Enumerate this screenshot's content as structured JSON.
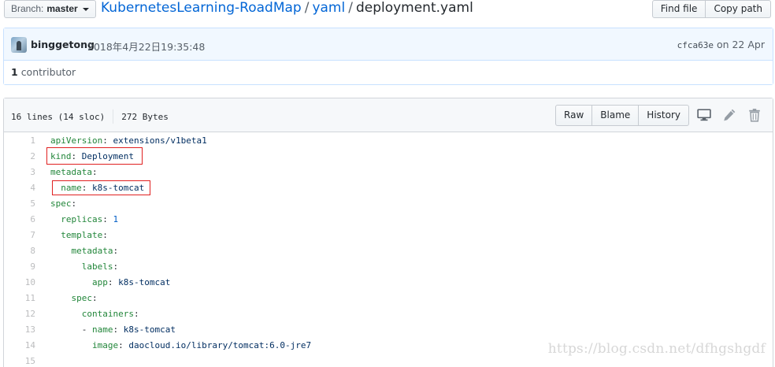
{
  "topbar": {
    "branch_label": "Branch:",
    "branch_value": "master",
    "repo": "KubernetesLearning-RoadMap",
    "separator": "/",
    "folder": "yaml",
    "file": "deployment.yaml",
    "find_file": "Find file",
    "copy_path": "Copy path"
  },
  "commit": {
    "author": "binggetong",
    "message": "2018年4月22日19:35:48",
    "sha": "cfca63e",
    "date_text": "on 22 Apr",
    "contributors_count": "1",
    "contributors_label": "contributor"
  },
  "file": {
    "lines_info": "16 lines (14 sloc)",
    "size": "272 Bytes",
    "raw": "Raw",
    "blame": "Blame",
    "history": "History",
    "icons": [
      "desktop-icon",
      "pencil-icon",
      "trash-icon"
    ],
    "lines": [
      {
        "n": "1",
        "indent": "",
        "key": "apiVersion",
        "val": "extensions/v1beta1",
        "num": false
      },
      {
        "n": "2",
        "indent": "",
        "key": "kind",
        "val": "Deployment",
        "num": false
      },
      {
        "n": "3",
        "indent": "",
        "key": "metadata",
        "val": "",
        "num": false
      },
      {
        "n": "4",
        "indent": "  ",
        "key": "name",
        "val": "k8s-tomcat",
        "num": false
      },
      {
        "n": "5",
        "indent": "",
        "key": "spec",
        "val": "",
        "num": false
      },
      {
        "n": "6",
        "indent": "  ",
        "key": "replicas",
        "val": "1",
        "num": true
      },
      {
        "n": "7",
        "indent": "  ",
        "key": "template",
        "val": "",
        "num": false
      },
      {
        "n": "8",
        "indent": "    ",
        "key": "metadata",
        "val": "",
        "num": false
      },
      {
        "n": "9",
        "indent": "      ",
        "key": "labels",
        "val": "",
        "num": false
      },
      {
        "n": "10",
        "indent": "        ",
        "key": "app",
        "val": "k8s-tomcat",
        "num": false
      },
      {
        "n": "11",
        "indent": "    ",
        "key": "spec",
        "val": "",
        "num": false
      },
      {
        "n": "12",
        "indent": "      ",
        "key": "containers",
        "val": "",
        "num": false
      },
      {
        "n": "13",
        "indent": "      - ",
        "key": "name",
        "val": "k8s-tomcat",
        "num": false
      },
      {
        "n": "14",
        "indent": "        ",
        "key": "image",
        "val": "daocloud.io/library/tomcat:6.0-jre7",
        "num": false
      },
      {
        "n": "15",
        "indent": "",
        "key": "",
        "val": "",
        "num": false
      }
    ]
  },
  "watermark": "https://blog.csdn.net/dfhgshgdf",
  "colors": {
    "link": "#0366d6",
    "yaml_key": "#22863a",
    "yaml_value": "#032f62",
    "highlight_box": "#e02020"
  }
}
